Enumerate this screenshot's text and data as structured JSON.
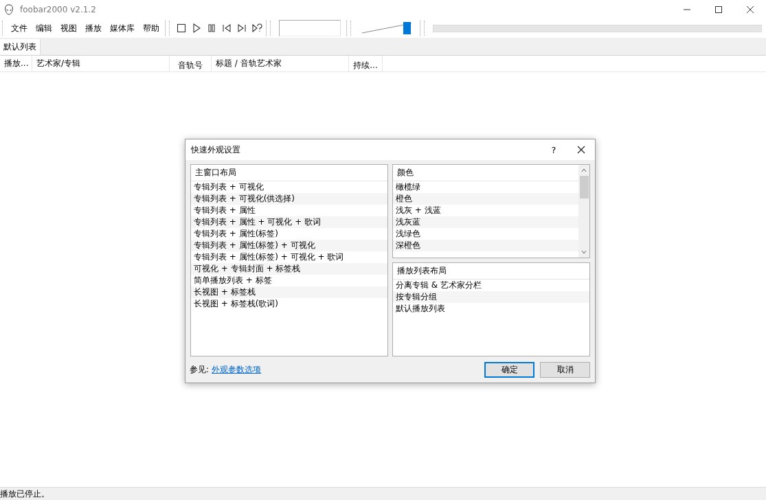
{
  "window": {
    "title": "foobar2000 v2.1.2"
  },
  "menu": [
    "文件",
    "编辑",
    "视图",
    "播放",
    "媒体库",
    "帮助"
  ],
  "volume": {
    "level": 0.95
  },
  "tabs": [
    {
      "label": "默认列表",
      "selected": true
    }
  ],
  "columns": [
    {
      "label": "播放..."
    },
    {
      "label": "艺术家/专辑"
    },
    {
      "label": "音轨号"
    },
    {
      "label": "标题 / 音轨艺术家"
    },
    {
      "label": "持续..."
    }
  ],
  "dialog": {
    "title": "快速外观设置",
    "help_button": "?",
    "main_layout": {
      "header": "主窗口布局",
      "items": [
        "专辑列表 + 可视化",
        "专辑列表 + 可视化(供选择)",
        "专辑列表 + 属性",
        "专辑列表 + 属性 + 可视化 + 歌词",
        "专辑列表 + 属性(标签)",
        "专辑列表 + 属性(标签) + 可视化",
        "专辑列表 + 属性(标签) + 可视化 + 歌词",
        "可视化 + 专辑封面 + 标签栈",
        "简单播放列表 + 标签",
        "长视图 + 标签栈",
        "长视图 + 标签栈(歌词)"
      ]
    },
    "colors": {
      "header": "颜色",
      "items": [
        "橄榄绿",
        "橙色",
        "浅灰 + 浅蓝",
        "浅灰蓝",
        "浅绿色",
        "深橙色"
      ]
    },
    "playlist_layout": {
      "header": "播放列表布局",
      "items": [
        "分离专辑 & 艺术家分栏",
        "按专辑分组",
        "默认播放列表"
      ]
    },
    "see_also_label": "参见:",
    "see_also_link": "外观参数选项",
    "buttons": [
      {
        "label": "确定",
        "default": true
      },
      {
        "label": "取消",
        "default": false
      }
    ]
  },
  "status_bar": "播放已停止。"
}
